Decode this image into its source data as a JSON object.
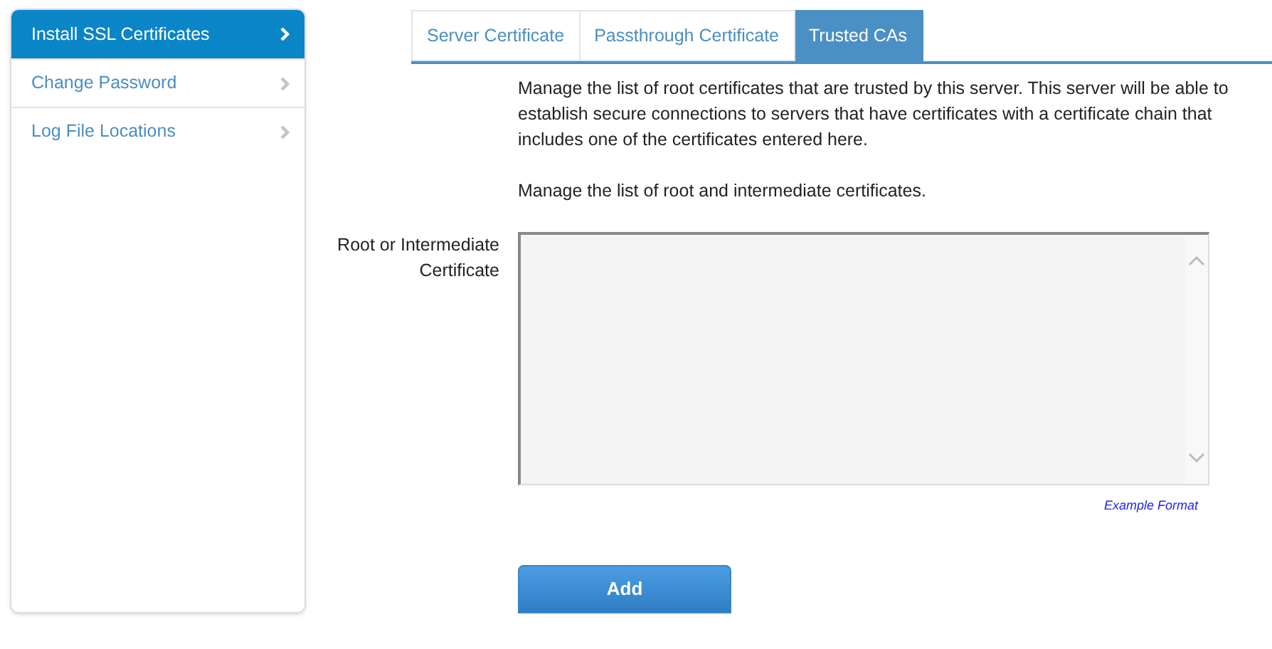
{
  "sidebar": {
    "items": [
      {
        "label": "Install SSL Certificates",
        "selected": true
      },
      {
        "label": "Change Password",
        "selected": false
      },
      {
        "label": "Log File Locations",
        "selected": false
      }
    ]
  },
  "tabs": [
    {
      "label": "Server Certificate",
      "selected": false
    },
    {
      "label": "Passthrough Certificate",
      "selected": false
    },
    {
      "label": "Trusted CAs",
      "selected": true
    }
  ],
  "description": [
    "Manage the list of root certificates that are trusted by this server. This server will be able to establish secure connections to servers that have certificates with a certificate chain that includes one of the certificates entered here.",
    "Manage the list of root and intermediate certificates."
  ],
  "certificate_field": {
    "label": "Root or Intermediate Certificate",
    "link": "Example Format"
  },
  "buttons": [
    "Add"
  ]
}
